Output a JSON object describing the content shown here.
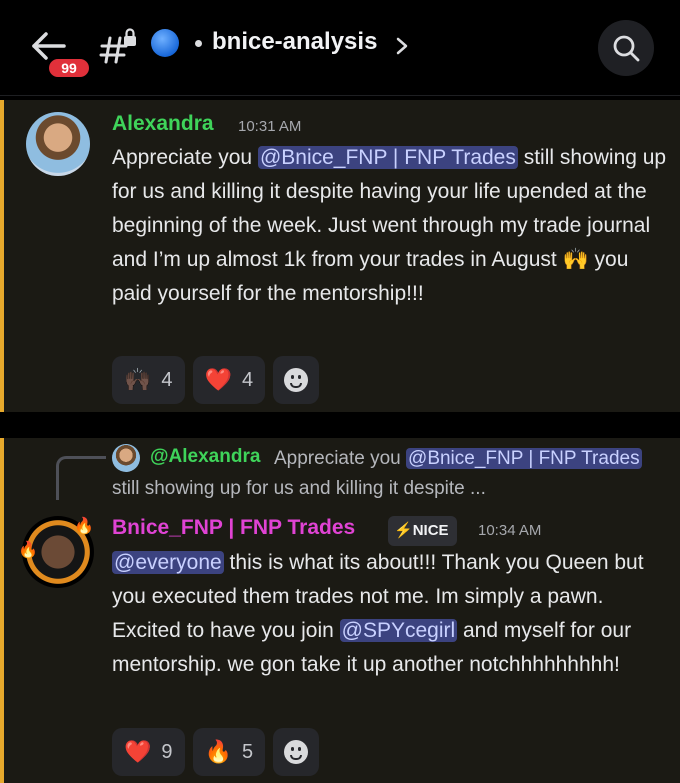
{
  "header": {
    "badge_count": "99",
    "channel_name": "bnice-analysis",
    "icons": [
      "back-arrow-icon",
      "locked-hash-icon",
      "globe-icon",
      "chevron-right-icon",
      "search-icon"
    ]
  },
  "messages": [
    {
      "author": "Alexandra",
      "author_color": "#3fd45a",
      "time": "10:31 AM",
      "text_parts": [
        "Appreciate you ",
        "@Bnice_FNP | FNP Trades",
        " still showing up for us and killing it despite having your life upended at the beginning of the week. Just went through my trade journal and I’m up almost 1k from your trades in August ",
        "🙌",
        " you paid yourself for the mentorship!!!"
      ],
      "reactions": [
        {
          "emoji": "🙌🏿",
          "count": "4"
        },
        {
          "emoji": "❤️",
          "count": "4"
        }
      ]
    },
    {
      "reply_to": {
        "author": "@Alexandra",
        "text_before": "Appreciate you ",
        "mention": "@Bnice_FNP | FNP Trades",
        "text_after": " still showing up for us and killing it despite ..."
      },
      "author": "Bnice_FNP | FNP Trades",
      "author_color": "#e043d4",
      "tag": "NICE",
      "tag_icon": "⚡",
      "time": "10:34 AM",
      "text_parts": [
        "@everyone",
        " this is what its about!!! Thank you Queen but you executed them trades not me. Im simply a pawn. Excited to have you join ",
        "@SPYcegirl",
        " and myself for our mentorship. we gon take it up another notchhhhhhhhh!"
      ],
      "reactions": [
        {
          "emoji": "❤️",
          "count": "9"
        },
        {
          "emoji": "🔥",
          "count": "5"
        }
      ]
    }
  ],
  "colors": {
    "highlight_bar": "#e6a92c",
    "mention_bg": "#3c4380",
    "badge": "#e0303a"
  }
}
